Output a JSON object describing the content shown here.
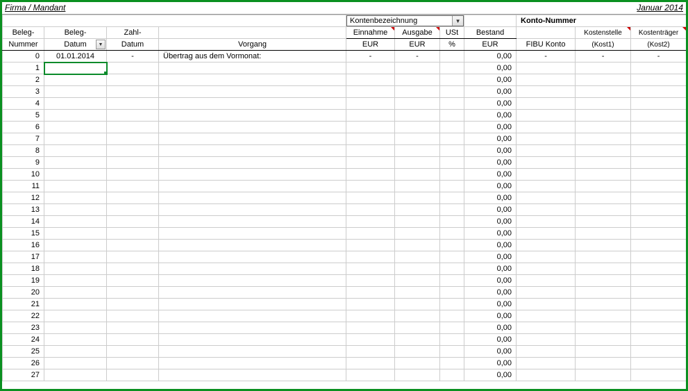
{
  "top": {
    "title": "Firma / Mandant",
    "date": "Januar 2014"
  },
  "dropdown": {
    "label": "Kontenbezeichnung"
  },
  "kontoNummer": "Konto-Nummer",
  "head1": {
    "beleg": "Beleg-",
    "belegD": "Beleg-",
    "zahl": "Zahl-",
    "einnahme": "Einnahme",
    "ausgabe": "Ausgabe",
    "ust": "USt",
    "bestand": "Bestand",
    "kostenstelle": "Kostenstelle",
    "kostentraeger": "Kostenträger"
  },
  "head2": {
    "nummer": "Nummer",
    "datum": "Datum",
    "datum2": "Datum",
    "vorgang": "Vorgang",
    "eur1": "EUR",
    "eur2": "EUR",
    "pct": "%",
    "eur3": "EUR",
    "fibu": "FIBU Konto",
    "kost1": "(Kost1)",
    "kost2": "(Kost2)"
  },
  "row0": {
    "num": "0",
    "datum": "01.01.2014",
    "zahl": "-",
    "vorgang": "Übertrag aus dem Vormonat:",
    "ein": "-",
    "aus": "-",
    "ust": "",
    "bestand": "0,00",
    "fibu": "-",
    "k1": "-",
    "k2": "-"
  },
  "bestandDefault": "0,00",
  "rowCount": 27
}
